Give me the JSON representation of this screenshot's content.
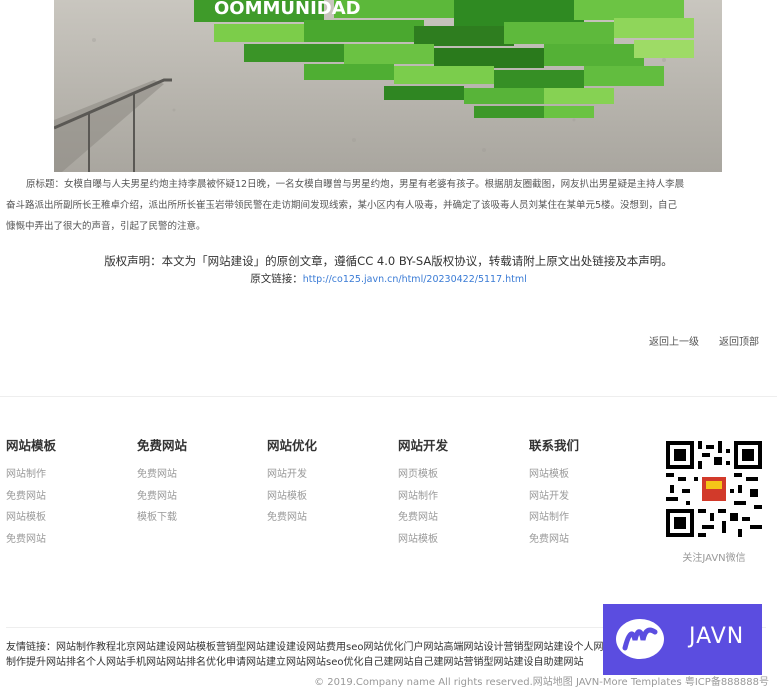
{
  "article": {
    "hero_sign_text": "OOMMUNIDAD",
    "caption_line1": "原标题：女模自曝与人夫男星约炮主持李晨被怀疑12日晚，一名女模自曝曾与男星约炮，男星有老婆有孩子。根据朋友圈截图，网友扒出男星疑是主持人李晨",
    "caption_line2": "奋斗路派出所副所长王稚卓介绍，派出所所长崔玉岩带领民警在走访期间发现线索，某小区内有人吸毒，并确定了该吸毒人员刘某住在某单元5楼。没想到，自己",
    "caption_line3": "慷慨中弄出了很大的声音，引起了民警的注意。",
    "copyright_notice": "版权声明：本文为「网站建设」的原创文章，遵循CC 4.0 BY-SA版权协议，转载请附上原文出处链接及本声明。",
    "source_label": "原文链接：",
    "source_url": "http://co125.javn.cn/html/20230422/5117.html",
    "back_up": "返回上一级",
    "back_top": "返回顶部"
  },
  "footer": {
    "columns": [
      {
        "title": "网站模板",
        "links": [
          "网站制作",
          "免费网站",
          "网站模板",
          "免费网站"
        ]
      },
      {
        "title": "免费网站",
        "links": [
          "免费网站",
          "免费网站",
          "模板下载"
        ]
      },
      {
        "title": "网站优化",
        "links": [
          "网站开发",
          "网站模板",
          "免费网站"
        ]
      },
      {
        "title": "网站开发",
        "links": [
          "网页模板",
          "网站制作",
          "免费网站",
          "网站模板"
        ]
      },
      {
        "title": "联系我们",
        "links": [
          "网站模板",
          "网站开发",
          "网站制作",
          "免费网站"
        ]
      }
    ],
    "qr_caption": "关注JAVN微信",
    "friends_label": "友情链接：",
    "friends_text": "网站制作教程北京网站建设网站模板营销型网站建设建设网站费用seo网站优化门户网站高端网站设计营销型网站建设个人网站制作提升网站排名个人网站手机网站网站排名优化申请网站建立网站网站seo优化自己建网站自己建网站营销型网站建设自助建网站",
    "bottom_line": "© 2019.Company name All rights reserved.网站地图 JAVN-More Templates 粤ICP备888888号"
  },
  "badge": {
    "text": "JAVN",
    "color": "#5b4de0"
  }
}
